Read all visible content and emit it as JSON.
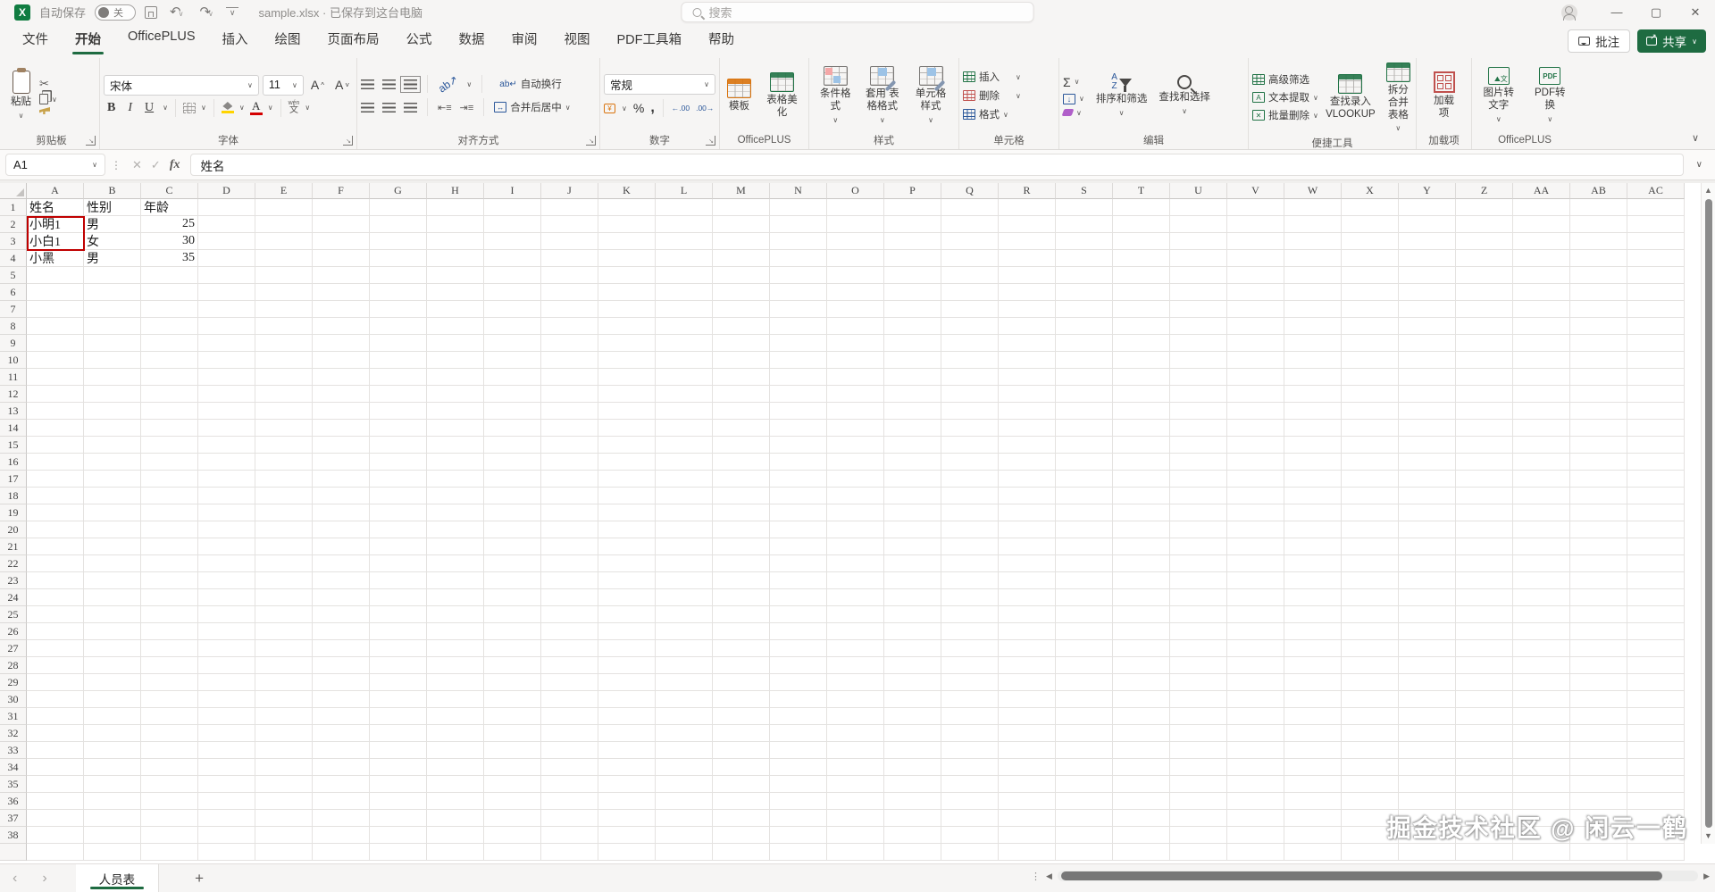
{
  "title_bar": {
    "app_initial": "X",
    "autosave_label": "自动保存",
    "autosave_state": "关",
    "filename": "sample.xlsx · 已保存到这台电脑",
    "search_placeholder": "搜索"
  },
  "tabs": {
    "items": [
      "文件",
      "开始",
      "OfficePLUS",
      "插入",
      "绘图",
      "页面布局",
      "公式",
      "数据",
      "审阅",
      "视图",
      "PDF工具箱",
      "帮助"
    ],
    "active": "开始",
    "comment_button": "批注",
    "share_button": "共享"
  },
  "ribbon": {
    "clipboard": {
      "label": "剪贴板",
      "paste": "粘贴"
    },
    "font": {
      "label": "字体",
      "font_name": "宋体",
      "font_size": "11",
      "bold": "B",
      "italic": "I",
      "underline": "U",
      "grow": "A^",
      "shrink": "A˅",
      "fill_glyph": "⬓",
      "color_glyph": "A",
      "phonetic_glyph": "文"
    },
    "alignment": {
      "label": "对齐方式",
      "wrap_text": "自动换行",
      "merge_center": "合并后居中",
      "orient_glyph": "ab↗"
    },
    "number": {
      "label": "数字",
      "format": "常规",
      "currency_glyph": "¥",
      "percent": "%",
      "comma": ",",
      "inc_dec": "←.00",
      "dec_dec": ".00→"
    },
    "officeplus1": {
      "label": "OfficePLUS",
      "template": "模板",
      "beautify": "表格美化"
    },
    "styles": {
      "label": "样式",
      "conditional": "条件格式",
      "format_table": "套用 表格格式",
      "cell_styles": "单元格样式"
    },
    "cells": {
      "label": "单元格",
      "insert": "插入",
      "delete": "删除",
      "format": "格式"
    },
    "editing": {
      "label": "编辑",
      "sum_glyph": "Σ",
      "fill_glyph": "↓",
      "clear_glyph": "◇",
      "sort_filter": "排序和筛选",
      "az": "A Z",
      "find_select": "查找和选择"
    },
    "tools": {
      "label": "便捷工具",
      "adv_filter": "高级筛选",
      "text_extract": "文本提取",
      "batch_delete": "批量删除",
      "vlookup": "查找录入 VLOOKUP",
      "split_merge": "拆分合并 表格"
    },
    "addins": {
      "label": "加载项",
      "addins": "加载项"
    },
    "officeplus2": {
      "label": "OfficePLUS",
      "img2text": "图片转 文字",
      "pdf_convert": "PDF转换"
    }
  },
  "formula_bar": {
    "name_box": "A1",
    "fx": "fx",
    "content": "姓名"
  },
  "grid": {
    "columns": [
      "A",
      "B",
      "C",
      "D",
      "E",
      "F",
      "G",
      "H",
      "I",
      "J",
      "K",
      "L",
      "M",
      "N",
      "O",
      "P",
      "Q",
      "R",
      "S",
      "T",
      "U",
      "V",
      "W",
      "X",
      "Y",
      "Z",
      "AA",
      "AB",
      "AC"
    ],
    "row_count": 38,
    "cells": {
      "1": [
        "姓名",
        "性别",
        "年龄"
      ],
      "2": [
        "小明1",
        "男",
        "25"
      ],
      "3": [
        "小白1",
        "女",
        "30"
      ],
      "4": [
        "小黑",
        "男",
        "35"
      ]
    },
    "red_border_range": "A2:A3"
  },
  "sheet_bar": {
    "tab": "人员表"
  },
  "watermark": "掘金技术社区 @ 闲云一鹤",
  "colors": {
    "excel_green": "#1e6b41",
    "red_border": "#c00000",
    "template_orange": "#d9730d",
    "tool_green": "#217346"
  }
}
